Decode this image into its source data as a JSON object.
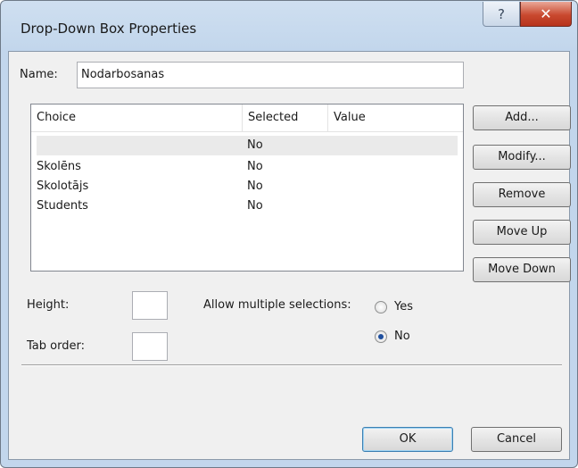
{
  "window": {
    "title": "Drop-Down Box Properties",
    "help_glyph": "?",
    "close_glyph": "✕"
  },
  "name_field": {
    "label": "Name:",
    "value": "Nodarbosanas"
  },
  "choices": {
    "headers": [
      "Choice",
      "Selected",
      "Value"
    ],
    "rows": [
      {
        "choice": "",
        "selected": "No",
        "value": ""
      },
      {
        "choice": "Skolēns",
        "selected": "No",
        "value": ""
      },
      {
        "choice": "Skolotājs",
        "selected": "No",
        "value": ""
      },
      {
        "choice": "Students",
        "selected": "No",
        "value": ""
      }
    ]
  },
  "side_buttons": {
    "add": "Add...",
    "modify": "Modify...",
    "remove": "Remove",
    "move_up": "Move Up",
    "move_down": "Move Down"
  },
  "height": {
    "label": "Height:",
    "value": ""
  },
  "tab_order": {
    "label": "Tab order:",
    "value": ""
  },
  "multiple": {
    "label": "Allow multiple selections:",
    "yes_label": "Yes",
    "no_label": "No",
    "selected": "No"
  },
  "footer": {
    "ok": "OK",
    "cancel": "Cancel"
  }
}
